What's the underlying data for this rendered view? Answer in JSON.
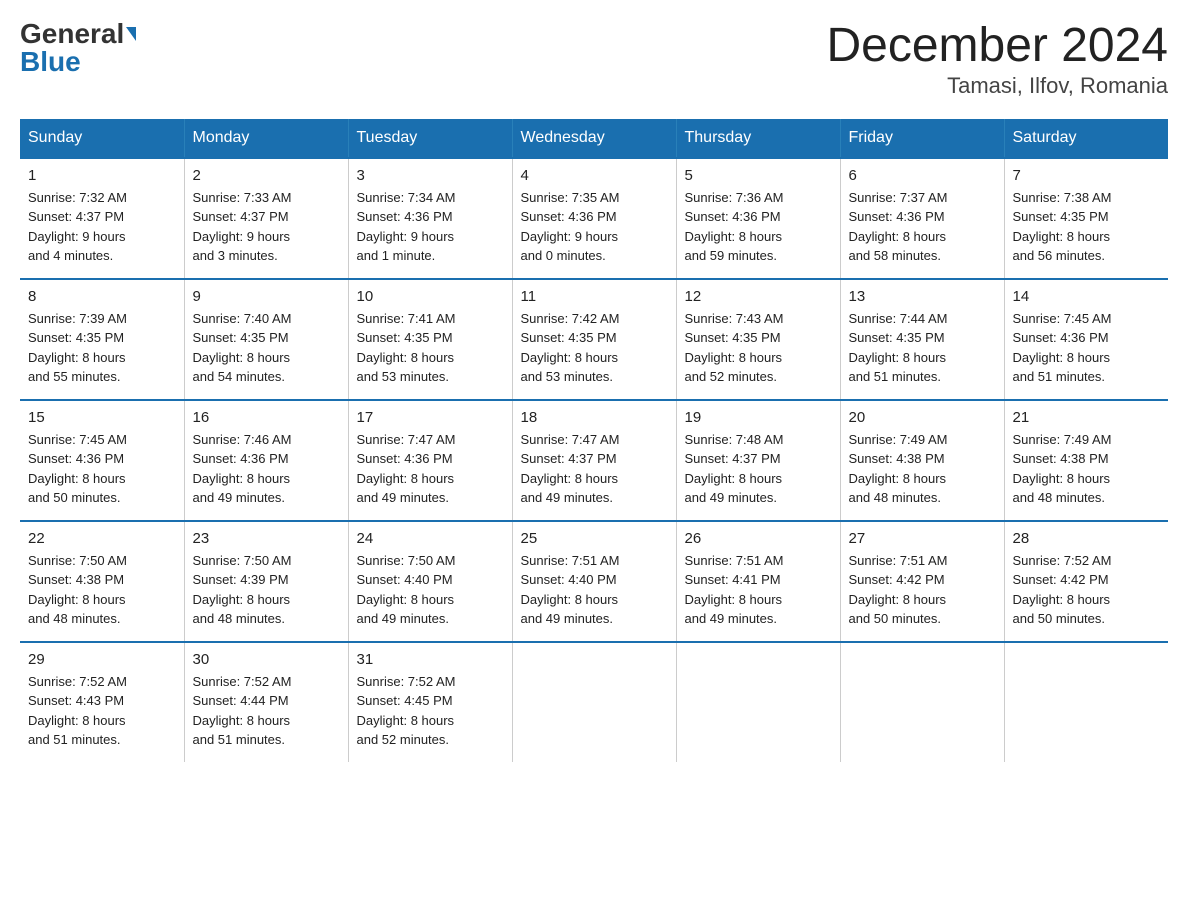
{
  "header": {
    "logo_general": "General",
    "logo_blue": "Blue",
    "month_title": "December 2024",
    "location": "Tamasi, Ilfov, Romania"
  },
  "days_of_week": [
    "Sunday",
    "Monday",
    "Tuesday",
    "Wednesday",
    "Thursday",
    "Friday",
    "Saturday"
  ],
  "weeks": [
    [
      {
        "day": "1",
        "sunrise": "7:32 AM",
        "sunset": "4:37 PM",
        "daylight": "9 hours and 4 minutes."
      },
      {
        "day": "2",
        "sunrise": "7:33 AM",
        "sunset": "4:37 PM",
        "daylight": "9 hours and 3 minutes."
      },
      {
        "day": "3",
        "sunrise": "7:34 AM",
        "sunset": "4:36 PM",
        "daylight": "9 hours and 1 minute."
      },
      {
        "day": "4",
        "sunrise": "7:35 AM",
        "sunset": "4:36 PM",
        "daylight": "9 hours and 0 minutes."
      },
      {
        "day": "5",
        "sunrise": "7:36 AM",
        "sunset": "4:36 PM",
        "daylight": "8 hours and 59 minutes."
      },
      {
        "day": "6",
        "sunrise": "7:37 AM",
        "sunset": "4:36 PM",
        "daylight": "8 hours and 58 minutes."
      },
      {
        "day": "7",
        "sunrise": "7:38 AM",
        "sunset": "4:35 PM",
        "daylight": "8 hours and 56 minutes."
      }
    ],
    [
      {
        "day": "8",
        "sunrise": "7:39 AM",
        "sunset": "4:35 PM",
        "daylight": "8 hours and 55 minutes."
      },
      {
        "day": "9",
        "sunrise": "7:40 AM",
        "sunset": "4:35 PM",
        "daylight": "8 hours and 54 minutes."
      },
      {
        "day": "10",
        "sunrise": "7:41 AM",
        "sunset": "4:35 PM",
        "daylight": "8 hours and 53 minutes."
      },
      {
        "day": "11",
        "sunrise": "7:42 AM",
        "sunset": "4:35 PM",
        "daylight": "8 hours and 53 minutes."
      },
      {
        "day": "12",
        "sunrise": "7:43 AM",
        "sunset": "4:35 PM",
        "daylight": "8 hours and 52 minutes."
      },
      {
        "day": "13",
        "sunrise": "7:44 AM",
        "sunset": "4:35 PM",
        "daylight": "8 hours and 51 minutes."
      },
      {
        "day": "14",
        "sunrise": "7:45 AM",
        "sunset": "4:36 PM",
        "daylight": "8 hours and 51 minutes."
      }
    ],
    [
      {
        "day": "15",
        "sunrise": "7:45 AM",
        "sunset": "4:36 PM",
        "daylight": "8 hours and 50 minutes."
      },
      {
        "day": "16",
        "sunrise": "7:46 AM",
        "sunset": "4:36 PM",
        "daylight": "8 hours and 49 minutes."
      },
      {
        "day": "17",
        "sunrise": "7:47 AM",
        "sunset": "4:36 PM",
        "daylight": "8 hours and 49 minutes."
      },
      {
        "day": "18",
        "sunrise": "7:47 AM",
        "sunset": "4:37 PM",
        "daylight": "8 hours and 49 minutes."
      },
      {
        "day": "19",
        "sunrise": "7:48 AM",
        "sunset": "4:37 PM",
        "daylight": "8 hours and 49 minutes."
      },
      {
        "day": "20",
        "sunrise": "7:49 AM",
        "sunset": "4:38 PM",
        "daylight": "8 hours and 48 minutes."
      },
      {
        "day": "21",
        "sunrise": "7:49 AM",
        "sunset": "4:38 PM",
        "daylight": "8 hours and 48 minutes."
      }
    ],
    [
      {
        "day": "22",
        "sunrise": "7:50 AM",
        "sunset": "4:38 PM",
        "daylight": "8 hours and 48 minutes."
      },
      {
        "day": "23",
        "sunrise": "7:50 AM",
        "sunset": "4:39 PM",
        "daylight": "8 hours and 48 minutes."
      },
      {
        "day": "24",
        "sunrise": "7:50 AM",
        "sunset": "4:40 PM",
        "daylight": "8 hours and 49 minutes."
      },
      {
        "day": "25",
        "sunrise": "7:51 AM",
        "sunset": "4:40 PM",
        "daylight": "8 hours and 49 minutes."
      },
      {
        "day": "26",
        "sunrise": "7:51 AM",
        "sunset": "4:41 PM",
        "daylight": "8 hours and 49 minutes."
      },
      {
        "day": "27",
        "sunrise": "7:51 AM",
        "sunset": "4:42 PM",
        "daylight": "8 hours and 50 minutes."
      },
      {
        "day": "28",
        "sunrise": "7:52 AM",
        "sunset": "4:42 PM",
        "daylight": "8 hours and 50 minutes."
      }
    ],
    [
      {
        "day": "29",
        "sunrise": "7:52 AM",
        "sunset": "4:43 PM",
        "daylight": "8 hours and 51 minutes."
      },
      {
        "day": "30",
        "sunrise": "7:52 AM",
        "sunset": "4:44 PM",
        "daylight": "8 hours and 51 minutes."
      },
      {
        "day": "31",
        "sunrise": "7:52 AM",
        "sunset": "4:45 PM",
        "daylight": "8 hours and 52 minutes."
      },
      null,
      null,
      null,
      null
    ]
  ],
  "labels": {
    "sunrise": "Sunrise:",
    "sunset": "Sunset:",
    "daylight": "Daylight:"
  }
}
